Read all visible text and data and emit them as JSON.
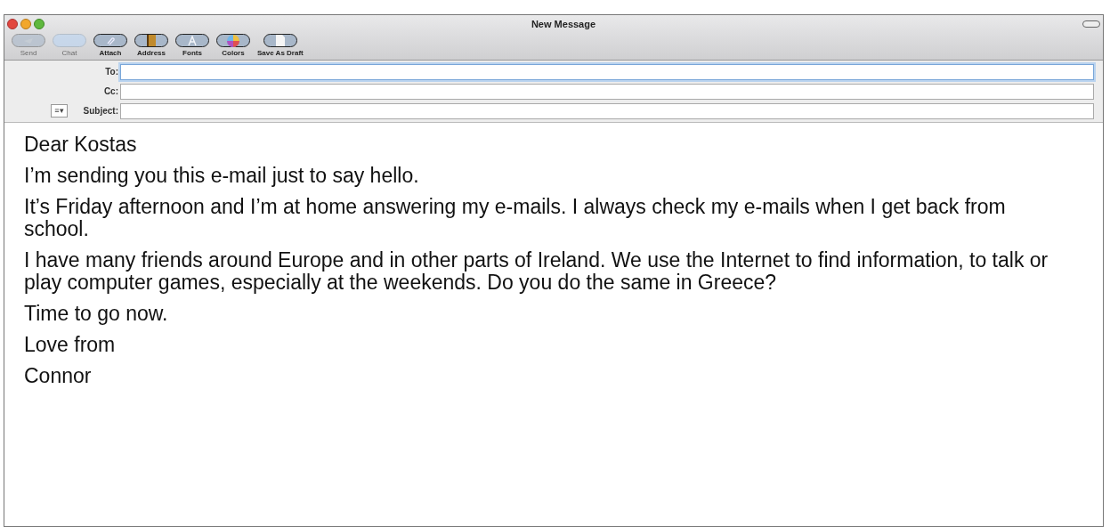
{
  "window": {
    "title": "New Message"
  },
  "toolbar": [
    {
      "label": "Send",
      "kind": "send",
      "disabled": true
    },
    {
      "label": "Chat",
      "kind": "chat",
      "disabled": true
    },
    {
      "label": "Attach",
      "kind": "attach",
      "disabled": false
    },
    {
      "label": "Address",
      "kind": "address",
      "disabled": false
    },
    {
      "label": "Fonts",
      "kind": "fonts",
      "disabled": false
    },
    {
      "label": "Colors",
      "kind": "colors",
      "disabled": false
    },
    {
      "label": "Save As Draft",
      "kind": "draft",
      "disabled": false
    }
  ],
  "menu_button": "≡▾",
  "fields": [
    {
      "label": "To:",
      "focused": true
    },
    {
      "label": "Cc:",
      "focused": false
    },
    {
      "label": "Subject:",
      "focused": false
    }
  ],
  "body": [
    "Dear Kostas",
    "I’m sending you this e-mail just to say hello.",
    "It’s Friday afternoon and I’m at home answering my e-mails. I always check my e-mails when I get back from school.",
    "I have many friends around Europe and in other parts of Ireland. We use the Internet to find information, to talk or play computer games, especially at the weekends. Do you do the same in Greece?",
    "Time to go now.",
    "Love from",
    "Connor"
  ]
}
